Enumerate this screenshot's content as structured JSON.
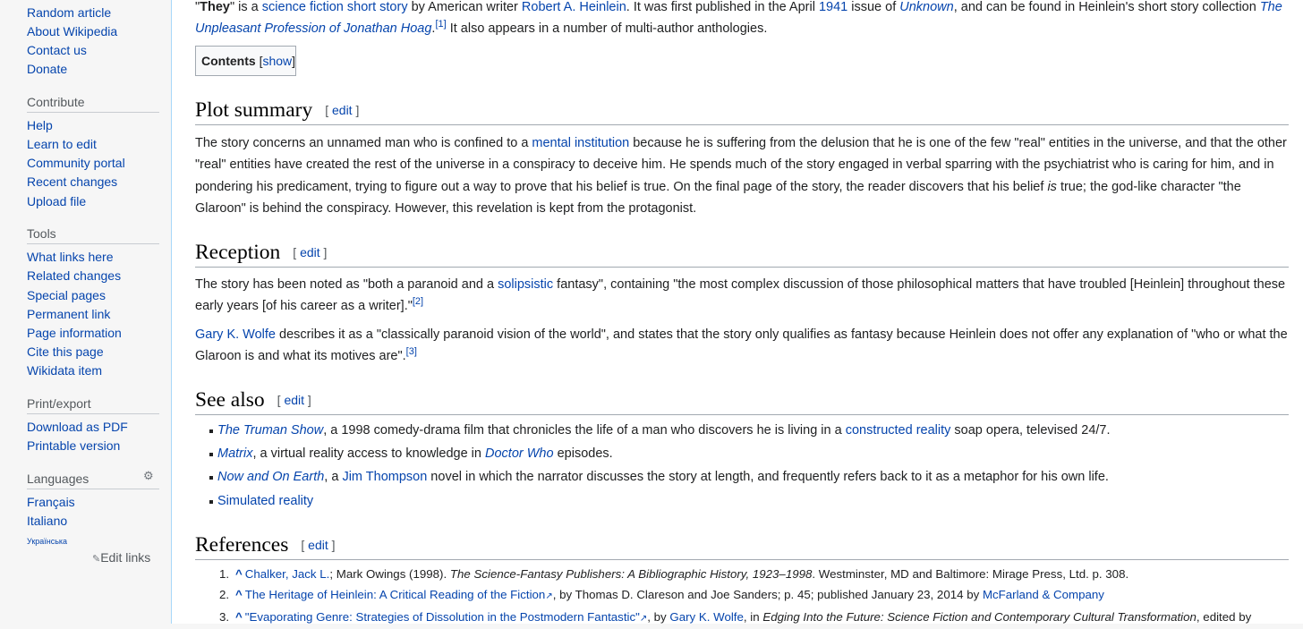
{
  "sidebar": {
    "nav": [
      "Random article",
      "About Wikipedia",
      "Contact us",
      "Donate"
    ],
    "contribute_heading": "Contribute",
    "contribute": [
      "Help",
      "Learn to edit",
      "Community portal",
      "Recent changes",
      "Upload file"
    ],
    "tools_heading": "Tools",
    "tools": [
      "What links here",
      "Related changes",
      "Special pages",
      "Permanent link",
      "Page information",
      "Cite this page",
      "Wikidata item"
    ],
    "print_heading": "Print/export",
    "print": [
      "Download as PDF",
      "Printable version"
    ],
    "languages_heading": "Languages",
    "languages": [
      "Français",
      "Italiano",
      "Українська"
    ],
    "edit_links": "Edit links"
  },
  "article": {
    "intro": {
      "q1": "\"",
      "title": "They",
      "q2": "\" is a ",
      "link1": "science fiction",
      "s1": " ",
      "link2": "short story",
      "s2": " by American writer ",
      "link3": "Robert A. Heinlein",
      "s3": ". It was first published in the April ",
      "link4": "1941",
      "s4": " issue of ",
      "link5": "Unknown",
      "s5": ", and can be found in Heinlein's short story collection ",
      "link6": "The Unpleasant Profession of Jonathan Hoag",
      "s6": ".",
      "ref": "[1]",
      "s7": " It also appears in a number of multi-author anthologies."
    },
    "toc": {
      "title": "Contents",
      "open": "[",
      "show": "show",
      "close": "]"
    },
    "edit_open": "[ ",
    "edit_label": "edit",
    "edit_close": " ]",
    "plot": {
      "heading": "Plot summary",
      "t1": "The story concerns an unnamed man who is confined to a ",
      "link1": "mental institution",
      "t2": " because he is suffering from the delusion that he is one of the few \"real\" entities in the universe, and that the other \"real\" entities have created the rest of the universe in a conspiracy to deceive him. He spends much of the story engaged in verbal sparring with the psychiatrist who is caring for him, and in pondering his predicament, trying to figure out a way to prove that his belief is true. On the final page of the story, the reader discovers that his belief ",
      "em": "is",
      "t3": " true; the god-like character \"the Glaroon\" is behind the conspiracy. However, this revelation is kept from the protagonist."
    },
    "reception": {
      "heading": "Reception",
      "p1a": "The story has been noted as \"both a paranoid and a ",
      "p1link": "solipsistic",
      "p1b": " fantasy\", containing \"the most complex discussion of those philosophical matters that have troubled [Heinlein] throughout these early years [of his career as a writer].\"",
      "p1ref": "[2]",
      "p2link": "Gary K. Wolfe",
      "p2a": " describes it as a \"classically paranoid vision of the world\", and states that the story only qualifies as fantasy because Heinlein does not offer any explanation of \"who or what the Glaroon is and what its motives are\".",
      "p2ref": "[3]"
    },
    "see_also": {
      "heading": "See also",
      "i1link": "The Truman Show",
      "i1a": ", a 1998 comedy-drama film that chronicles the life of a man who discovers he is living in a ",
      "i1link2": "constructed reality",
      "i1b": " soap opera, televised 24/7.",
      "i2link": "Matrix",
      "i2a": ", a virtual reality access to knowledge in ",
      "i2link2": "Doctor Who",
      "i2b": " episodes.",
      "i3link": "Now and On Earth",
      "i3a": ", a ",
      "i3link2": "Jim Thompson",
      "i3b": " novel in which the narrator discusses the story at length, and frequently refers back to it as a metaphor for his own life.",
      "i4link": "Simulated reality"
    },
    "references": {
      "heading": "References",
      "r1": {
        "num": "1.",
        "caret": "^",
        "link": "Chalker, Jack L.",
        "a": "; Mark Owings (1998). ",
        "em": "The Science-Fantasy Publishers: A Bibliographic History, 1923–1998",
        "b": ". Westminster, MD and Baltimore: Mirage Press, Ltd. p. 308."
      },
      "r2": {
        "num": "2.",
        "caret": "^",
        "link": "The Heritage of Heinlein: A Critical Reading of the Fiction",
        "a": ", by Thomas D. Clareson and Joe Sanders; p. 45; published January 23, 2014 by ",
        "link2": "McFarland & Company"
      },
      "r3": {
        "num": "3.",
        "caret": "^",
        "link": "\"Evaporating Genre: Strategies of Dissolution in the Postmodern Fantastic\"",
        "a": ", by ",
        "link2": "Gary K. Wolfe",
        "b": ", in ",
        "em": "Edging Into the Future: Science Fiction and Contemporary Cultural Transformation",
        "c": ", edited by"
      }
    }
  },
  "colors": {
    "link": "#0645ad",
    "text": "#202122",
    "sidebar_bg": "#f6f6f6",
    "border": "#a7d7f9"
  }
}
